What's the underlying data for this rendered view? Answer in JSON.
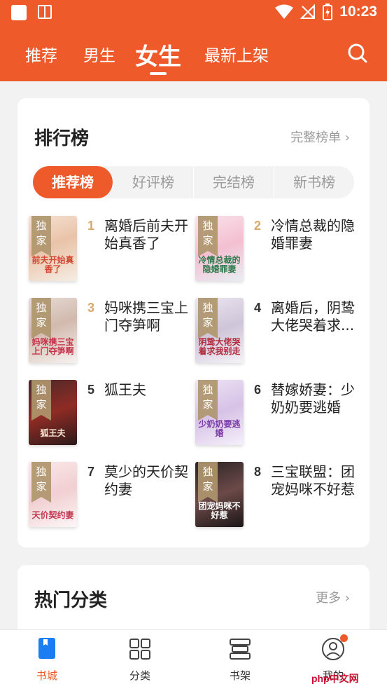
{
  "status_bar": {
    "time": "10:23"
  },
  "top_nav": {
    "tabs": [
      {
        "label": "推荐"
      },
      {
        "label": "男生"
      },
      {
        "label": "女生"
      },
      {
        "label": "最新上架"
      }
    ],
    "active_tab": "女生"
  },
  "ranking": {
    "title": "排行榜",
    "more_label": "完整榜单 ›",
    "segments": [
      {
        "label": "推荐榜"
      },
      {
        "label": "好评榜"
      },
      {
        "label": "完结榜"
      },
      {
        "label": "新书榜"
      }
    ],
    "active_segment": "推荐榜",
    "books": [
      {
        "rank": "1",
        "title": "离婚后前夫开始真香了",
        "badge": "独家",
        "cover_text": "前夫开始真香了"
      },
      {
        "rank": "2",
        "title": "冷情总裁的隐婚罪妻",
        "badge": "独家",
        "cover_text": "冷情总裁的隐婚罪妻"
      },
      {
        "rank": "3",
        "title": "妈咪携三宝上门夺笋啊",
        "badge": "独家",
        "cover_text": "妈咪携三宝上门夺笋啊"
      },
      {
        "rank": "4",
        "title": "离婚后，阴鸷大佬哭着求...",
        "badge": "独家",
        "cover_text": "阴鸷大佬哭着求我别走"
      },
      {
        "rank": "5",
        "title": "狐王夫",
        "badge": "独家",
        "cover_text": "狐王夫"
      },
      {
        "rank": "6",
        "title": "替嫁娇妻：少奶奶要逃婚",
        "badge": "独家",
        "cover_text": "少奶奶要逃婚"
      },
      {
        "rank": "7",
        "title": "莫少的天价契约妻",
        "badge": "独家",
        "cover_text": "天价契约妻"
      },
      {
        "rank": "8",
        "title": "三宝联盟：团宠妈咪不好惹",
        "badge": "独家",
        "cover_text": "团宠妈咪不好惹"
      }
    ]
  },
  "categories": {
    "title": "热门分类",
    "more_label": "更多 ›"
  },
  "bottom_nav": {
    "items": [
      {
        "label": "书城",
        "icon": "book-icon"
      },
      {
        "label": "分类",
        "icon": "grid-icon"
      },
      {
        "label": "书架",
        "icon": "bookshelf-icon"
      },
      {
        "label": "我的",
        "icon": "user-icon"
      }
    ],
    "active": "书城"
  },
  "watermark": "php中文网",
  "colors": {
    "accent": "#ef5a2b",
    "rank_highlight": "#d8a96a"
  }
}
